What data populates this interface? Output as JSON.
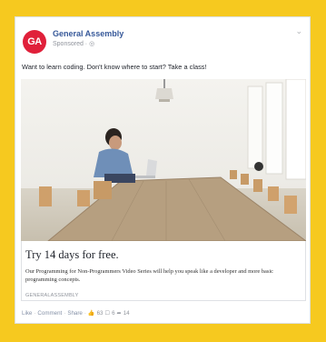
{
  "ad": {
    "logo_text": "GA",
    "page_name": "General Assembly",
    "sponsored": "Sponsored · ◎",
    "post_text": "Want to learn coding. Don't know where to start? Take a class!",
    "headline": "Try 14 days for free.",
    "description": "Our Programming for Non-Programmers Video Series will help you speak like a developer and more basic programming concepts.",
    "domain": "GENERALASSEMBLY"
  },
  "actions": {
    "like": "Like",
    "comment": "Comment",
    "share": "Share",
    "likes_count": "63",
    "comments_count": "6",
    "shares_count": "14"
  },
  "colors": {
    "background": "#f6c91f",
    "brand": "#e0203a",
    "link": "#365899"
  }
}
